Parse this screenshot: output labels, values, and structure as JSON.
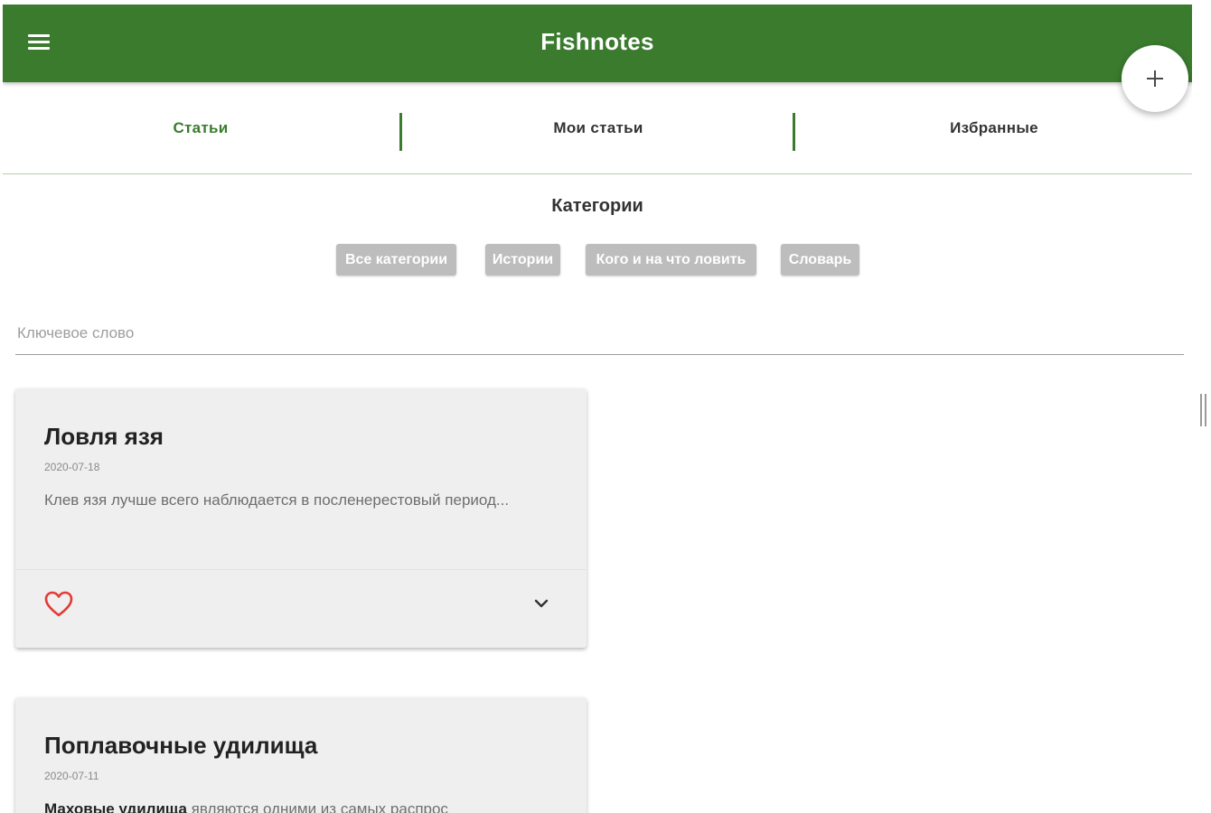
{
  "header": {
    "title": "Fishnotes",
    "menu_icon": "menu-icon",
    "add_icon": "plus-icon",
    "brand_color": "#3a7b2e"
  },
  "tabs": [
    {
      "label": "Статьи",
      "active": true
    },
    {
      "label": "Мои статьи",
      "active": false
    },
    {
      "label": "Избранные",
      "active": false
    }
  ],
  "categories": {
    "title": "Категории",
    "chips": [
      {
        "label": "Все категории"
      },
      {
        "label": "Истории"
      },
      {
        "label": "Кого и на что ловить"
      },
      {
        "label": "Словарь"
      }
    ]
  },
  "search": {
    "placeholder": "Ключевое слово",
    "value": ""
  },
  "articles": [
    {
      "title": "Ловля язя",
      "date": "2020-07-18",
      "excerpt": "Клев язя лучше всего наблюдается в посленерестовый период...",
      "favorite_icon": "heart-outline-icon",
      "expand_icon": "chevron-down-icon"
    },
    {
      "title": "Поплавочные удилища",
      "date": "2020-07-11",
      "excerpt_bold": "Маховые удилища",
      "excerpt_rest": " являются одними из самых распрос"
    }
  ]
}
